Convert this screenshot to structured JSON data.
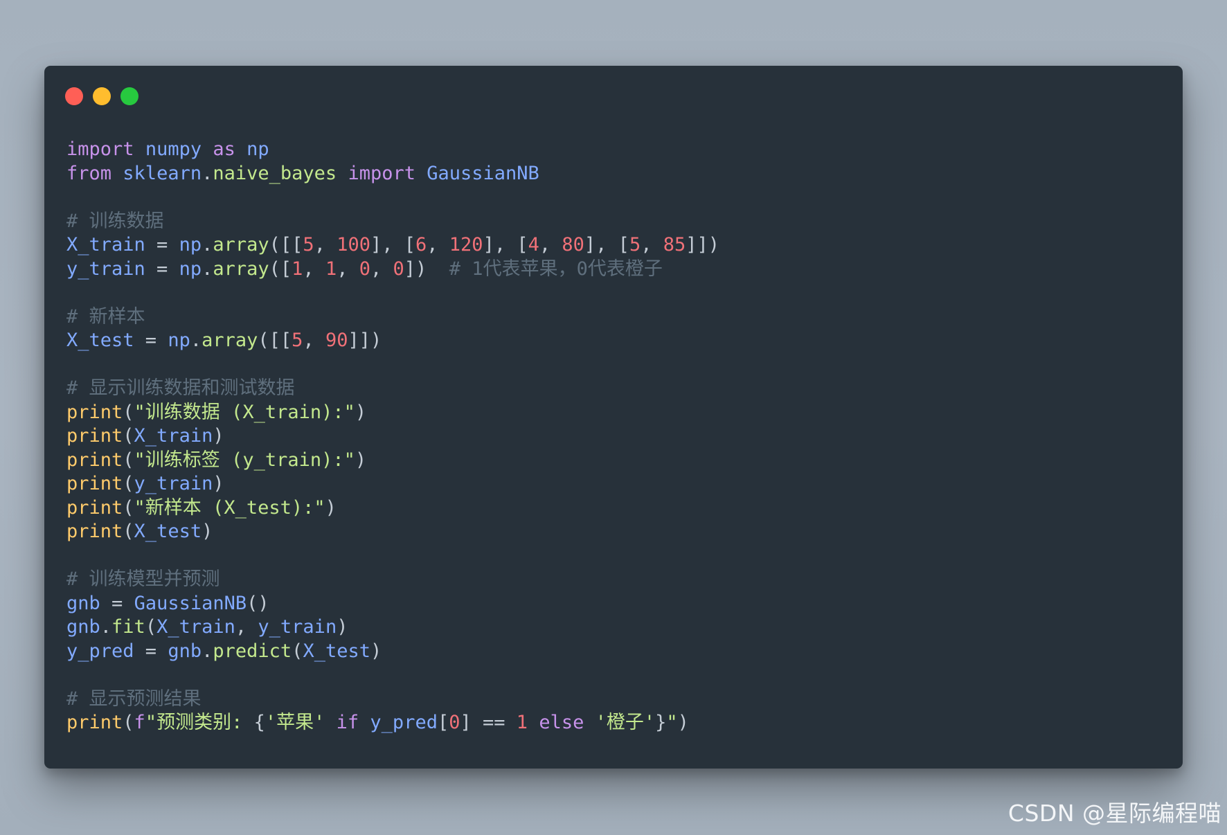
{
  "window": {
    "controls": [
      {
        "name": "close",
        "color": "#ff5f56"
      },
      {
        "name": "minimize",
        "color": "#ffbd2e"
      },
      {
        "name": "maximize",
        "color": "#27c93f"
      }
    ]
  },
  "code": {
    "language": "python",
    "lines": [
      [
        {
          "t": "kw",
          "v": "import"
        },
        {
          "t": "pn",
          "v": " "
        },
        {
          "t": "var",
          "v": "numpy"
        },
        {
          "t": "pn",
          "v": " "
        },
        {
          "t": "kw",
          "v": "as"
        },
        {
          "t": "pn",
          "v": " "
        },
        {
          "t": "var",
          "v": "np"
        }
      ],
      [
        {
          "t": "kw",
          "v": "from"
        },
        {
          "t": "pn",
          "v": " "
        },
        {
          "t": "var",
          "v": "sklearn"
        },
        {
          "t": "pn",
          "v": "."
        },
        {
          "t": "mod",
          "v": "naive_bayes"
        },
        {
          "t": "pn",
          "v": " "
        },
        {
          "t": "kw",
          "v": "import"
        },
        {
          "t": "pn",
          "v": " "
        },
        {
          "t": "cls",
          "v": "GaussianNB"
        }
      ],
      [],
      [
        {
          "t": "cmt",
          "v": "# 训练数据"
        }
      ],
      [
        {
          "t": "var",
          "v": "X_train"
        },
        {
          "t": "op",
          "v": " = "
        },
        {
          "t": "var",
          "v": "np"
        },
        {
          "t": "pn",
          "v": "."
        },
        {
          "t": "fn",
          "v": "array"
        },
        {
          "t": "pn",
          "v": "([["
        },
        {
          "t": "num",
          "v": "5"
        },
        {
          "t": "pn",
          "v": ", "
        },
        {
          "t": "num",
          "v": "100"
        },
        {
          "t": "pn",
          "v": "], ["
        },
        {
          "t": "num",
          "v": "6"
        },
        {
          "t": "pn",
          "v": ", "
        },
        {
          "t": "num",
          "v": "120"
        },
        {
          "t": "pn",
          "v": "], ["
        },
        {
          "t": "num",
          "v": "4"
        },
        {
          "t": "pn",
          "v": ", "
        },
        {
          "t": "num",
          "v": "80"
        },
        {
          "t": "pn",
          "v": "], ["
        },
        {
          "t": "num",
          "v": "5"
        },
        {
          "t": "pn",
          "v": ", "
        },
        {
          "t": "num",
          "v": "85"
        },
        {
          "t": "pn",
          "v": "]])"
        }
      ],
      [
        {
          "t": "var",
          "v": "y_train"
        },
        {
          "t": "op",
          "v": " = "
        },
        {
          "t": "var",
          "v": "np"
        },
        {
          "t": "pn",
          "v": "."
        },
        {
          "t": "fn",
          "v": "array"
        },
        {
          "t": "pn",
          "v": "(["
        },
        {
          "t": "num",
          "v": "1"
        },
        {
          "t": "pn",
          "v": ", "
        },
        {
          "t": "num",
          "v": "1"
        },
        {
          "t": "pn",
          "v": ", "
        },
        {
          "t": "num",
          "v": "0"
        },
        {
          "t": "pn",
          "v": ", "
        },
        {
          "t": "num",
          "v": "0"
        },
        {
          "t": "pn",
          "v": "])  "
        },
        {
          "t": "cmt",
          "v": "# 1代表苹果，0代表橙子"
        }
      ],
      [],
      [
        {
          "t": "cmt",
          "v": "# 新样本"
        }
      ],
      [
        {
          "t": "var",
          "v": "X_test"
        },
        {
          "t": "op",
          "v": " = "
        },
        {
          "t": "var",
          "v": "np"
        },
        {
          "t": "pn",
          "v": "."
        },
        {
          "t": "fn",
          "v": "array"
        },
        {
          "t": "pn",
          "v": "([["
        },
        {
          "t": "num",
          "v": "5"
        },
        {
          "t": "pn",
          "v": ", "
        },
        {
          "t": "num",
          "v": "90"
        },
        {
          "t": "pn",
          "v": "]])"
        }
      ],
      [],
      [
        {
          "t": "cmt",
          "v": "# 显示训练数据和测试数据"
        }
      ],
      [
        {
          "t": "bi",
          "v": "print"
        },
        {
          "t": "pn",
          "v": "("
        },
        {
          "t": "str",
          "v": "\"训练数据 (X_train):\""
        },
        {
          "t": "pn",
          "v": ")"
        }
      ],
      [
        {
          "t": "bi",
          "v": "print"
        },
        {
          "t": "pn",
          "v": "("
        },
        {
          "t": "var",
          "v": "X_train"
        },
        {
          "t": "pn",
          "v": ")"
        }
      ],
      [
        {
          "t": "bi",
          "v": "print"
        },
        {
          "t": "pn",
          "v": "("
        },
        {
          "t": "str",
          "v": "\"训练标签 (y_train):\""
        },
        {
          "t": "pn",
          "v": ")"
        }
      ],
      [
        {
          "t": "bi",
          "v": "print"
        },
        {
          "t": "pn",
          "v": "("
        },
        {
          "t": "var",
          "v": "y_train"
        },
        {
          "t": "pn",
          "v": ")"
        }
      ],
      [
        {
          "t": "bi",
          "v": "print"
        },
        {
          "t": "pn",
          "v": "("
        },
        {
          "t": "str",
          "v": "\"新样本 (X_test):\""
        },
        {
          "t": "pn",
          "v": ")"
        }
      ],
      [
        {
          "t": "bi",
          "v": "print"
        },
        {
          "t": "pn",
          "v": "("
        },
        {
          "t": "var",
          "v": "X_test"
        },
        {
          "t": "pn",
          "v": ")"
        }
      ],
      [],
      [
        {
          "t": "cmt",
          "v": "# 训练模型并预测"
        }
      ],
      [
        {
          "t": "var",
          "v": "gnb"
        },
        {
          "t": "op",
          "v": " = "
        },
        {
          "t": "cls",
          "v": "GaussianNB"
        },
        {
          "t": "pn",
          "v": "()"
        }
      ],
      [
        {
          "t": "var",
          "v": "gnb"
        },
        {
          "t": "pn",
          "v": "."
        },
        {
          "t": "fn",
          "v": "fit"
        },
        {
          "t": "pn",
          "v": "("
        },
        {
          "t": "var",
          "v": "X_train"
        },
        {
          "t": "pn",
          "v": ", "
        },
        {
          "t": "var",
          "v": "y_train"
        },
        {
          "t": "pn",
          "v": ")"
        }
      ],
      [
        {
          "t": "var",
          "v": "y_pred"
        },
        {
          "t": "op",
          "v": " = "
        },
        {
          "t": "var",
          "v": "gnb"
        },
        {
          "t": "pn",
          "v": "."
        },
        {
          "t": "fn",
          "v": "predict"
        },
        {
          "t": "pn",
          "v": "("
        },
        {
          "t": "var",
          "v": "X_test"
        },
        {
          "t": "pn",
          "v": ")"
        }
      ],
      [],
      [
        {
          "t": "cmt",
          "v": "# 显示预测结果"
        }
      ],
      [
        {
          "t": "bi",
          "v": "print"
        },
        {
          "t": "pn",
          "v": "("
        },
        {
          "t": "kw",
          "v": "f"
        },
        {
          "t": "str",
          "v": "\"预测类别: "
        },
        {
          "t": "pn",
          "v": "{"
        },
        {
          "t": "str",
          "v": "'苹果'"
        },
        {
          "t": "pn",
          "v": " "
        },
        {
          "t": "kw",
          "v": "if"
        },
        {
          "t": "pn",
          "v": " "
        },
        {
          "t": "var",
          "v": "y_pred"
        },
        {
          "t": "pn",
          "v": "["
        },
        {
          "t": "num",
          "v": "0"
        },
        {
          "t": "pn",
          "v": "]"
        },
        {
          "t": "op",
          "v": " == "
        },
        {
          "t": "num",
          "v": "1"
        },
        {
          "t": "pn",
          "v": " "
        },
        {
          "t": "kw",
          "v": "else"
        },
        {
          "t": "pn",
          "v": " "
        },
        {
          "t": "str",
          "v": "'橙子'"
        },
        {
          "t": "pn",
          "v": "}"
        },
        {
          "t": "str",
          "v": "\""
        },
        {
          "t": "pn",
          "v": ")"
        }
      ]
    ]
  },
  "watermark": {
    "text": "CSDN @星际编程喵"
  }
}
